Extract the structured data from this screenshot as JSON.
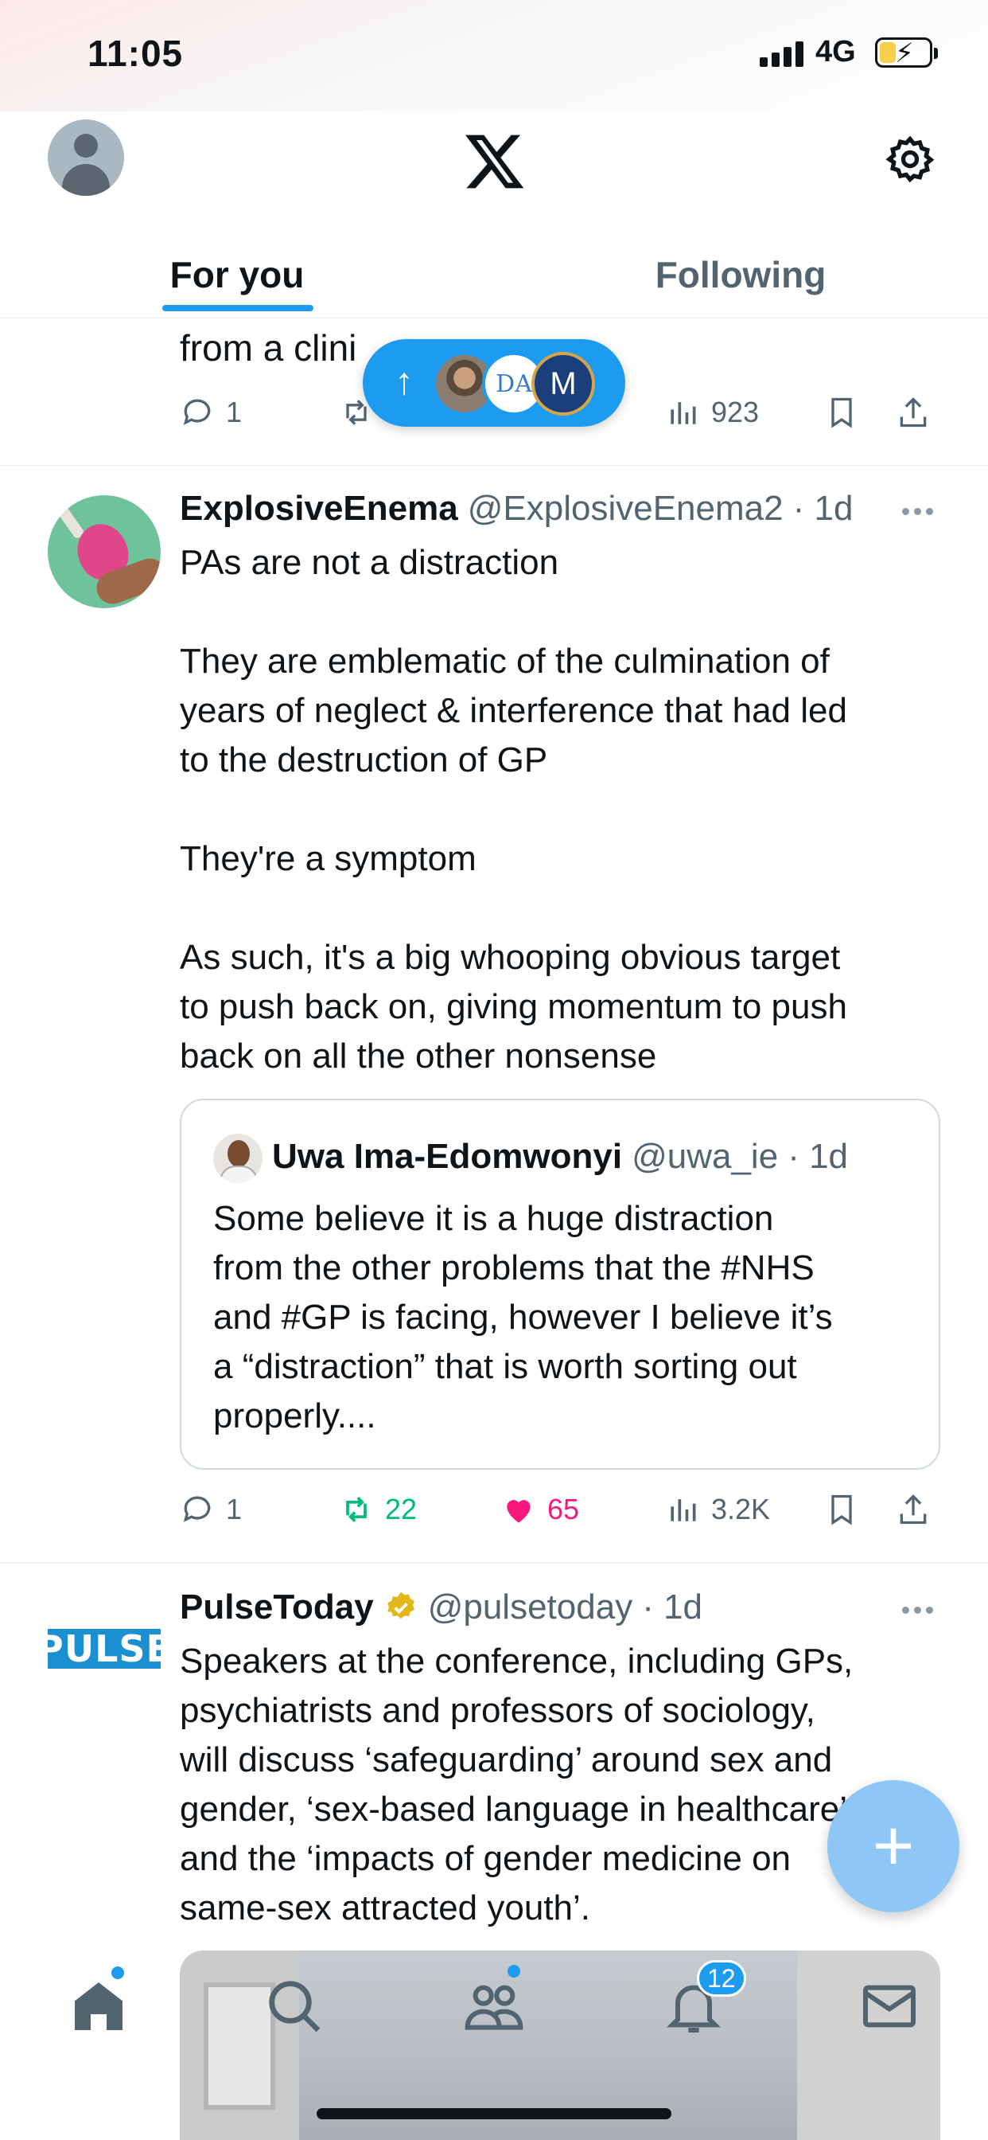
{
  "status_bar": {
    "time": "11:05",
    "network": "4G"
  },
  "header": {
    "tabs": [
      {
        "label": "For you"
      },
      {
        "label": "Following"
      }
    ]
  },
  "new_posts_pill": {
    "avatars": [
      "photo",
      "DA",
      "M"
    ]
  },
  "post1": {
    "visible_text": "from a clini",
    "replies": "1",
    "views": "923"
  },
  "post2": {
    "display_name": "ExplosiveEnema",
    "handle": "@ExplosiveEnema2",
    "time": "· 1d",
    "lines": [
      "PAs are not a distraction",
      "",
      "They are emblematic of the culmination of",
      "years of neglect & interference that had led",
      "to the destruction of GP",
      "",
      "They're a symptom",
      "",
      "As such, it's a big whooping obvious target",
      "to push back on, giving momentum to push",
      "back on all the other nonsense"
    ],
    "quote": {
      "display_name": "Uwa Ima-Edomwonyi",
      "handle": "@uwa_ie",
      "time": "· 1d",
      "lines": [
        "Some believe it is a huge distraction",
        "from the other problems that the #NHS",
        "and #GP is facing, however I believe it’s",
        "a “distraction” that is worth sorting out",
        "properly...."
      ]
    },
    "replies": "1",
    "reposts": "22",
    "likes": "65",
    "views": "3.2K"
  },
  "post3": {
    "logo_text": "PULSE",
    "display_name": "PulseToday",
    "handle": "@pulsetoday",
    "time": "· 1d",
    "lines": [
      "Speakers at the conference, including GPs,",
      "psychiatrists and professors of sociology,",
      "will discuss ‘safeguarding’ around sex and",
      "gender, ‘sex-based language in healthcare’,",
      "and the ‘impacts of gender medicine on",
      "same-sex attracted youth’."
    ]
  },
  "bottom_nav": {
    "items": [
      "home-icon",
      "search-icon",
      "communities-icon",
      "notifications-icon",
      "messages-icon"
    ],
    "notifications_badge": "12"
  },
  "colors": {
    "accent": "#1d9bf0",
    "like": "#f91880",
    "repost": "#00ba7c",
    "text": "#0f1419",
    "muted": "#536471"
  }
}
